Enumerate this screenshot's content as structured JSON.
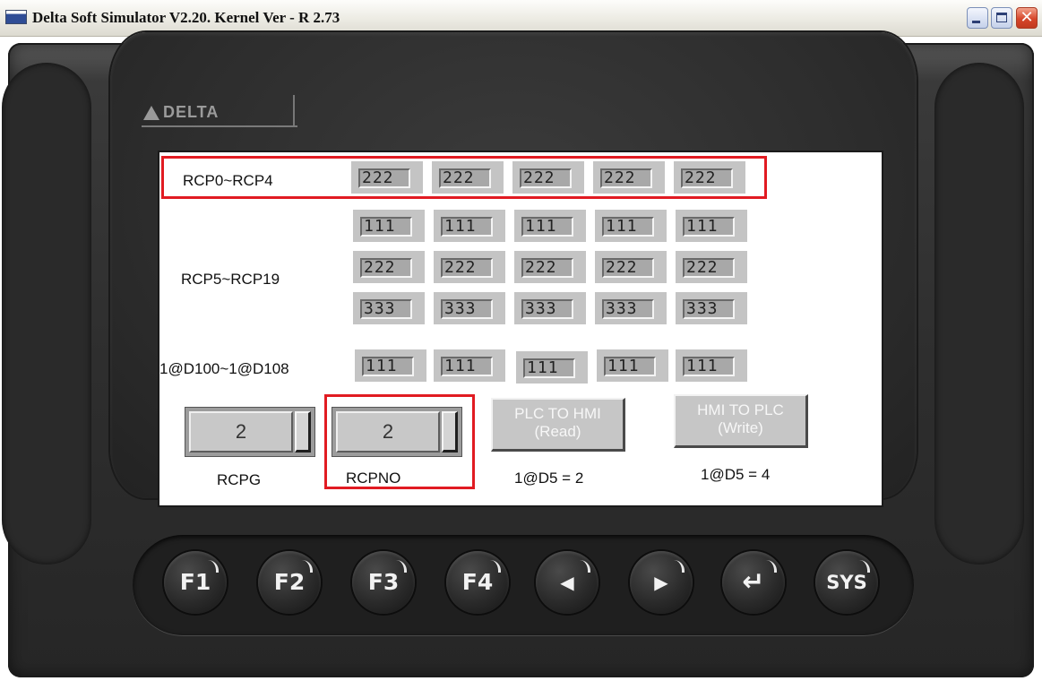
{
  "window": {
    "title": "Delta Soft Simulator V2.20. Kernel Ver - R 2.73",
    "minimize_glyph": "",
    "maximize_glyph": "",
    "close_glyph": "✕"
  },
  "device": {
    "brand": "DELTA"
  },
  "screen": {
    "row1": {
      "label": "RCP0~RCP4",
      "values": [
        "222",
        "222",
        "222",
        "222",
        "222"
      ]
    },
    "group2": {
      "label": "RCP5~RCP19",
      "rows": [
        [
          "111",
          "111",
          "111",
          "111",
          "111"
        ],
        [
          "222",
          "222",
          "222",
          "222",
          "222"
        ],
        [
          "333",
          "333",
          "333",
          "333",
          "333"
        ]
      ]
    },
    "row3": {
      "label": "1@D100~1@D108",
      "values": [
        "111",
        "111",
        "111",
        "111",
        "111"
      ]
    },
    "rcpg": {
      "value": "2",
      "label": "RCPG"
    },
    "rcpno": {
      "value": "2",
      "label": "RCPNO"
    },
    "read_button": {
      "line1": "PLC TO HMI",
      "line2": "(Read)",
      "caption": "1@D5 = 2"
    },
    "write_button": {
      "line1": "HMI TO PLC",
      "line2": "(Write)",
      "caption": "1@D5 = 4"
    }
  },
  "keypad": {
    "keys": [
      "F1",
      "F2",
      "F3",
      "F4",
      "◀",
      "▶",
      "↵",
      "SYS"
    ],
    "key_icons": [
      "",
      "",
      "",
      "",
      "left-arrow-icon",
      "right-arrow-icon",
      "enter-icon",
      ""
    ]
  },
  "colors": {
    "highlight": "#e11b22",
    "led": "#e3e21a",
    "device_body": "#2e2e2e"
  }
}
